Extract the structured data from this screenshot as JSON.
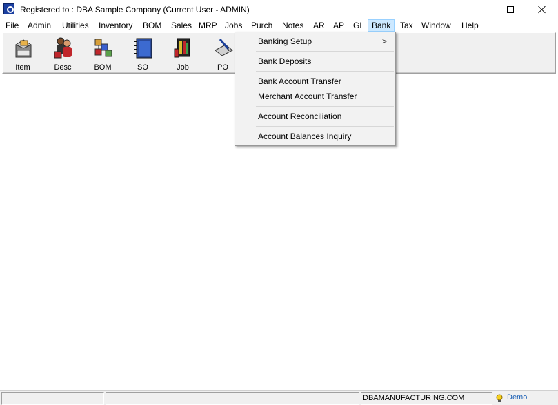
{
  "window": {
    "title": "Registered to : DBA Sample Company (Current User - ADMIN)",
    "controls": [
      "minimize-icon",
      "maximize-icon",
      "close-icon"
    ]
  },
  "menubar": {
    "items": [
      "File",
      "Admin",
      "Utilities",
      "Inventory",
      "BOM",
      "Sales",
      "MRP",
      "Jobs",
      "Purch",
      "Notes",
      "AR",
      "AP",
      "GL",
      "Bank",
      "Tax",
      "Window",
      "Help"
    ],
    "active": "Bank"
  },
  "toolbar": {
    "buttons": [
      {
        "label": "Item",
        "icon": "item-box-icon"
      },
      {
        "label": "Desc",
        "icon": "desc-people-icon"
      },
      {
        "label": "BOM",
        "icon": "bom-blocks-icon"
      },
      {
        "label": "SO",
        "icon": "so-notebook-icon"
      },
      {
        "label": "Job",
        "icon": "job-books-icon"
      },
      {
        "label": "PO",
        "icon": "po-pen-icon"
      }
    ]
  },
  "bank_menu": {
    "items": [
      {
        "label": "Banking Setup",
        "submenu_arrow": ">"
      },
      {
        "label": "Bank Deposits"
      },
      {
        "label": "Bank Account Transfer"
      },
      {
        "label": "Merchant Account Transfer"
      },
      {
        "label": "Account Reconciliation"
      },
      {
        "label": "Account Balances Inquiry"
      }
    ]
  },
  "statusbar": {
    "panels": [
      "",
      "",
      "DBAMANUFACTURING.COM"
    ],
    "mode_icon": "lightbulb-icon",
    "mode": "Demo"
  },
  "colors": {
    "menu_active_bg": "#cce8ff",
    "menu_active_border": "#99d1ff",
    "toolbar_bg": "#f0f0f0",
    "dropdown_bg": "#f2f2f2",
    "demo_text": "#1a5fb4"
  }
}
